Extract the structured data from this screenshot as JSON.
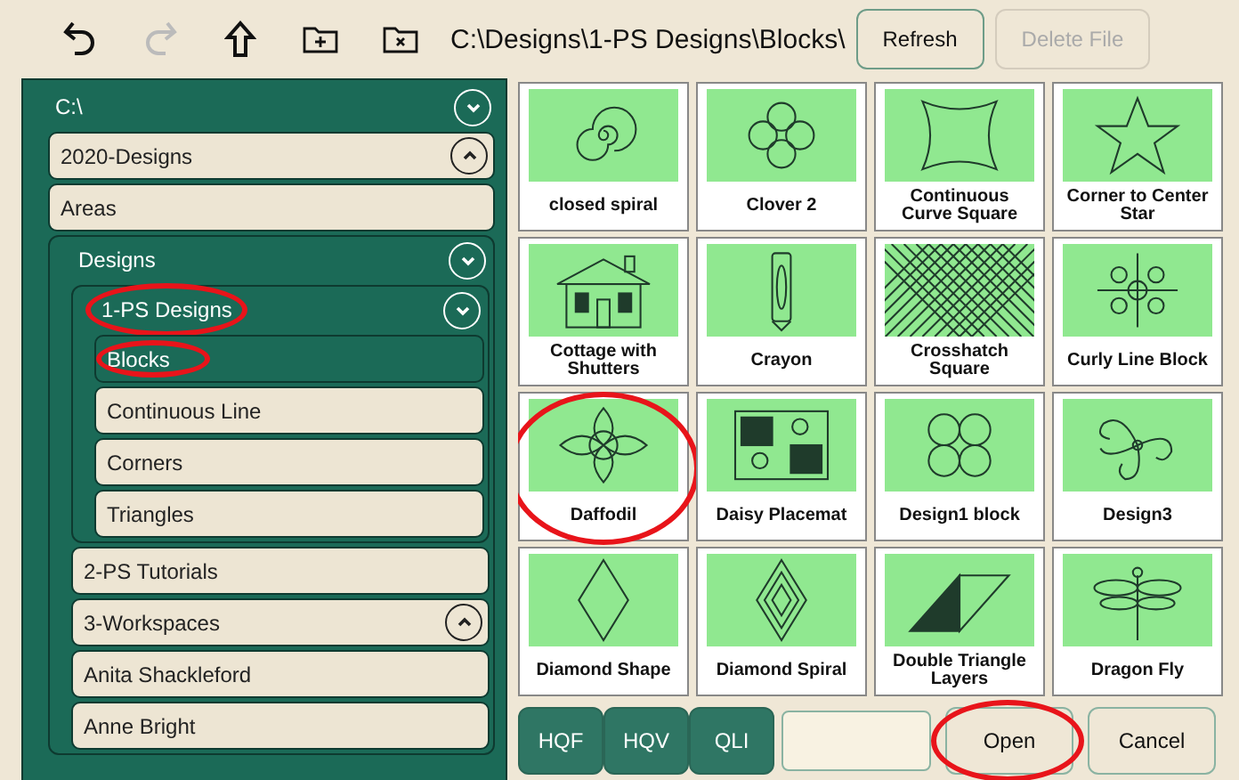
{
  "toolbar": {
    "tools": [
      {
        "kind": "undo",
        "disabled": false
      },
      {
        "kind": "redo",
        "disabled": true
      },
      {
        "kind": "up",
        "disabled": false
      },
      {
        "kind": "new-folder",
        "disabled": false
      },
      {
        "kind": "delete-folder",
        "disabled": false
      }
    ],
    "path": "C:\\Designs\\1-PS Designs\\Blocks\\",
    "buttons": [
      {
        "label": "Refresh",
        "disabled": false
      },
      {
        "label": "Delete File",
        "disabled": true
      }
    ]
  },
  "tree": {
    "label": "C:\\",
    "expanded": true,
    "selected": false,
    "circled": false,
    "children": [
      {
        "label": "2020-Designs",
        "expanded": false,
        "selected": false,
        "circled": false
      },
      {
        "label": "Areas",
        "selected": false,
        "circled": false
      },
      {
        "label": "Designs",
        "expanded": true,
        "selected": false,
        "circled": false,
        "children": [
          {
            "label": "1-PS Designs",
            "expanded": true,
            "selected": false,
            "circled": true,
            "children": [
              {
                "label": "Blocks",
                "selected": true,
                "circled": true
              },
              {
                "label": "Continuous Line",
                "selected": false,
                "circled": false
              },
              {
                "label": "Corners",
                "selected": false,
                "circled": false
              },
              {
                "label": "Triangles",
                "selected": false,
                "circled": false
              }
            ]
          },
          {
            "label": "2-PS Tutorials",
            "selected": false,
            "circled": false
          },
          {
            "label": "3-Workspaces",
            "expanded": false,
            "selected": false,
            "circled": false
          },
          {
            "label": "Anita Shackleford",
            "selected": false,
            "circled": false
          },
          {
            "label": "Anne Bright",
            "selected": false,
            "circled": false
          }
        ]
      }
    ]
  },
  "tiles": [
    {
      "label": "closed spiral",
      "circled": false
    },
    {
      "label": "Clover 2",
      "circled": false
    },
    {
      "label": "Continuous Curve Square",
      "circled": false
    },
    {
      "label": "Corner to Center Star",
      "circled": false
    },
    {
      "label": "Cottage with Shutters",
      "circled": false
    },
    {
      "label": "Crayon",
      "circled": false
    },
    {
      "label": "Crosshatch Square",
      "circled": false
    },
    {
      "label": "Curly Line Block",
      "circled": false
    },
    {
      "label": "Daffodil",
      "circled": true
    },
    {
      "label": "Daisy Placemat",
      "circled": false
    },
    {
      "label": "Design1 block",
      "circled": false
    },
    {
      "label": "Design3",
      "circled": false
    },
    {
      "label": "Diamond Shape",
      "circled": false
    },
    {
      "label": "Diamond Spiral",
      "circled": false
    },
    {
      "label": "Double Triangle Layers",
      "circled": false
    },
    {
      "label": "Dragon Fly",
      "circled": false
    }
  ],
  "footer": {
    "buttons": [
      {
        "label": "HQF",
        "kind": "format",
        "circled": false
      },
      {
        "label": "HQV",
        "kind": "format",
        "circled": false
      },
      {
        "label": "QLI",
        "kind": "format",
        "circled": false
      }
    ],
    "actions": [
      {
        "label": "Open",
        "kind": "action",
        "circled": true
      },
      {
        "label": "Cancel",
        "kind": "action",
        "circled": false
      }
    ]
  }
}
